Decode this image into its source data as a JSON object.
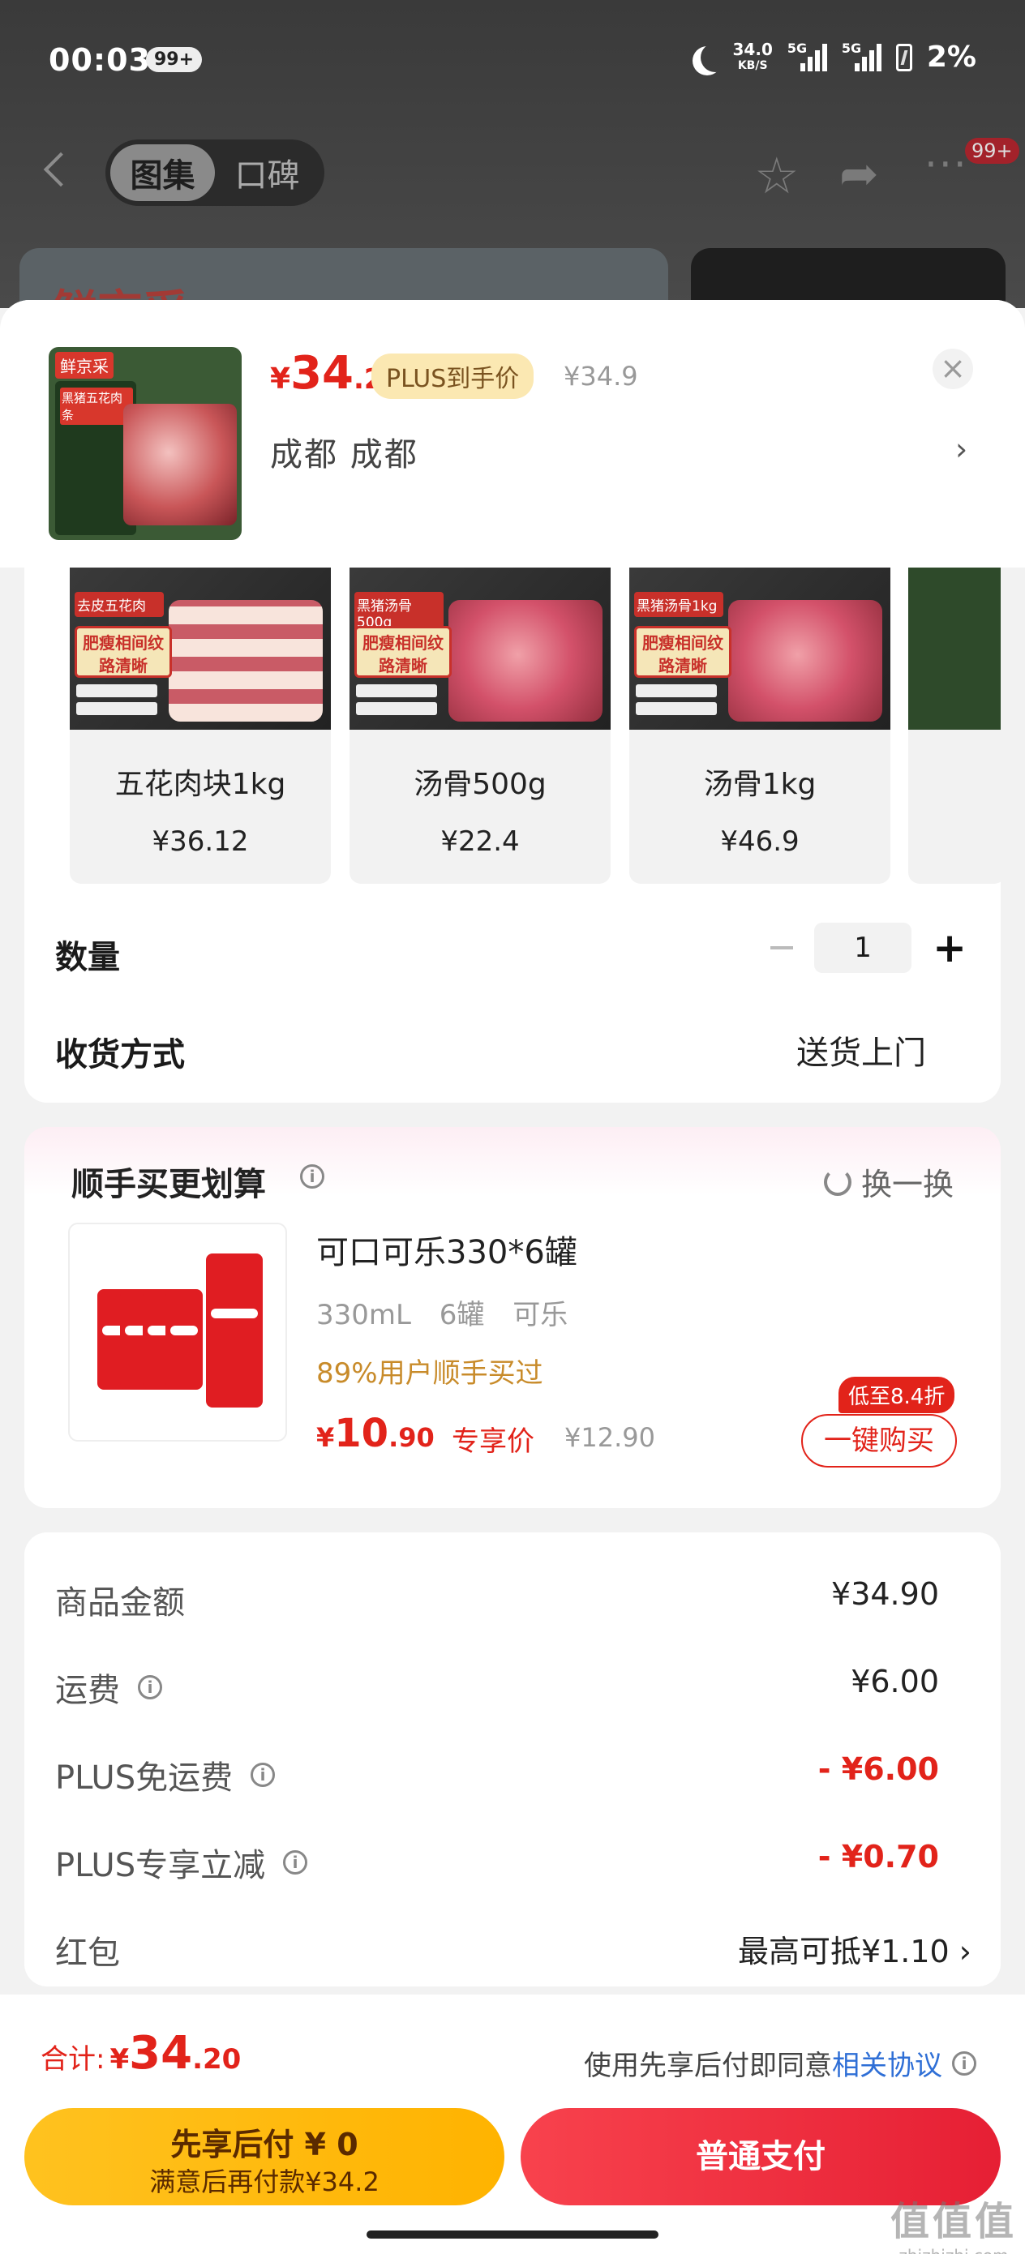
{
  "status_bar": {
    "time": "00:03",
    "notif_badge": "99+",
    "net_speed_value": "34.0",
    "net_speed_unit": "KB/S",
    "signal1_label": "5G",
    "signal2_label": "5G",
    "battery": "2%"
  },
  "nav": {
    "tabs": [
      "图集",
      "口碑"
    ],
    "more_badge": "99+",
    "bg_card_text": "鲜京采"
  },
  "product": {
    "price_currency": "¥",
    "price_int": "34",
    "price_dec": ".2",
    "plus_tag": "PLUS到手价",
    "orig_price": "¥34.9",
    "location": "成都 成都",
    "thumb_brand": "鲜京采",
    "thumb_title": "黑猪五花肉条"
  },
  "variants": [
    {
      "name": "五花肉块1kg",
      "price": "¥36.12",
      "tag": "去皮五花肉",
      "badge": "肥瘦相间纹路清晰"
    },
    {
      "name": "汤骨500g",
      "price": "¥22.4",
      "tag": "黑猪汤骨500g",
      "badge": "肥瘦相间纹路清晰"
    },
    {
      "name": "汤骨1kg",
      "price": "¥46.9",
      "tag": "黑猪汤骨1kg",
      "badge": "肥瘦相间纹路清晰"
    }
  ],
  "quantity": {
    "label": "数量",
    "value": "1"
  },
  "delivery": {
    "label": "收货方式",
    "value": "送货上门"
  },
  "addon": {
    "title": "顺手买更划算",
    "refresh": "换一换",
    "name": "可口可乐330*6罐",
    "spec": "330mL 6罐 可乐",
    "social": "89%用户顺手买过",
    "price_currency": "¥",
    "price_int": "10",
    "price_dec": ".90",
    "price_tag": "专享价",
    "orig_price": "¥12.90",
    "discount": "低至8.4折",
    "buy_label": "一键购买"
  },
  "summary": [
    {
      "label": "商品金额",
      "value": "¥34.90",
      "info": false,
      "style": "normal"
    },
    {
      "label": "运费",
      "value": "¥6.00",
      "info": true,
      "style": "normal"
    },
    {
      "label": "PLUS免运费",
      "value": "- ¥6.00",
      "info": true,
      "style": "red"
    },
    {
      "label": "PLUS专享立减",
      "value": "- ¥0.70",
      "info": true,
      "style": "red"
    },
    {
      "label": "红包",
      "value": "最高可抵¥1.10 ›",
      "info": false,
      "style": "chev"
    }
  ],
  "footer": {
    "total_label": "合计:",
    "total_currency": "¥",
    "total_int": "34",
    "total_dec": ".20",
    "agree_text": "使用先享后付即同意",
    "agree_link": "相关协议",
    "later_line1": "先享后付 ¥ 0",
    "later_line2": "满意后再付款¥34.2",
    "pay_label": "普通支付"
  },
  "watermark": {
    "line1": "值值值",
    "line2": "zhizhizhi.com"
  },
  "colors": {
    "accent_red": "#e2231a",
    "gold": "#ffc21f",
    "link_blue": "#2f6fd6"
  }
}
